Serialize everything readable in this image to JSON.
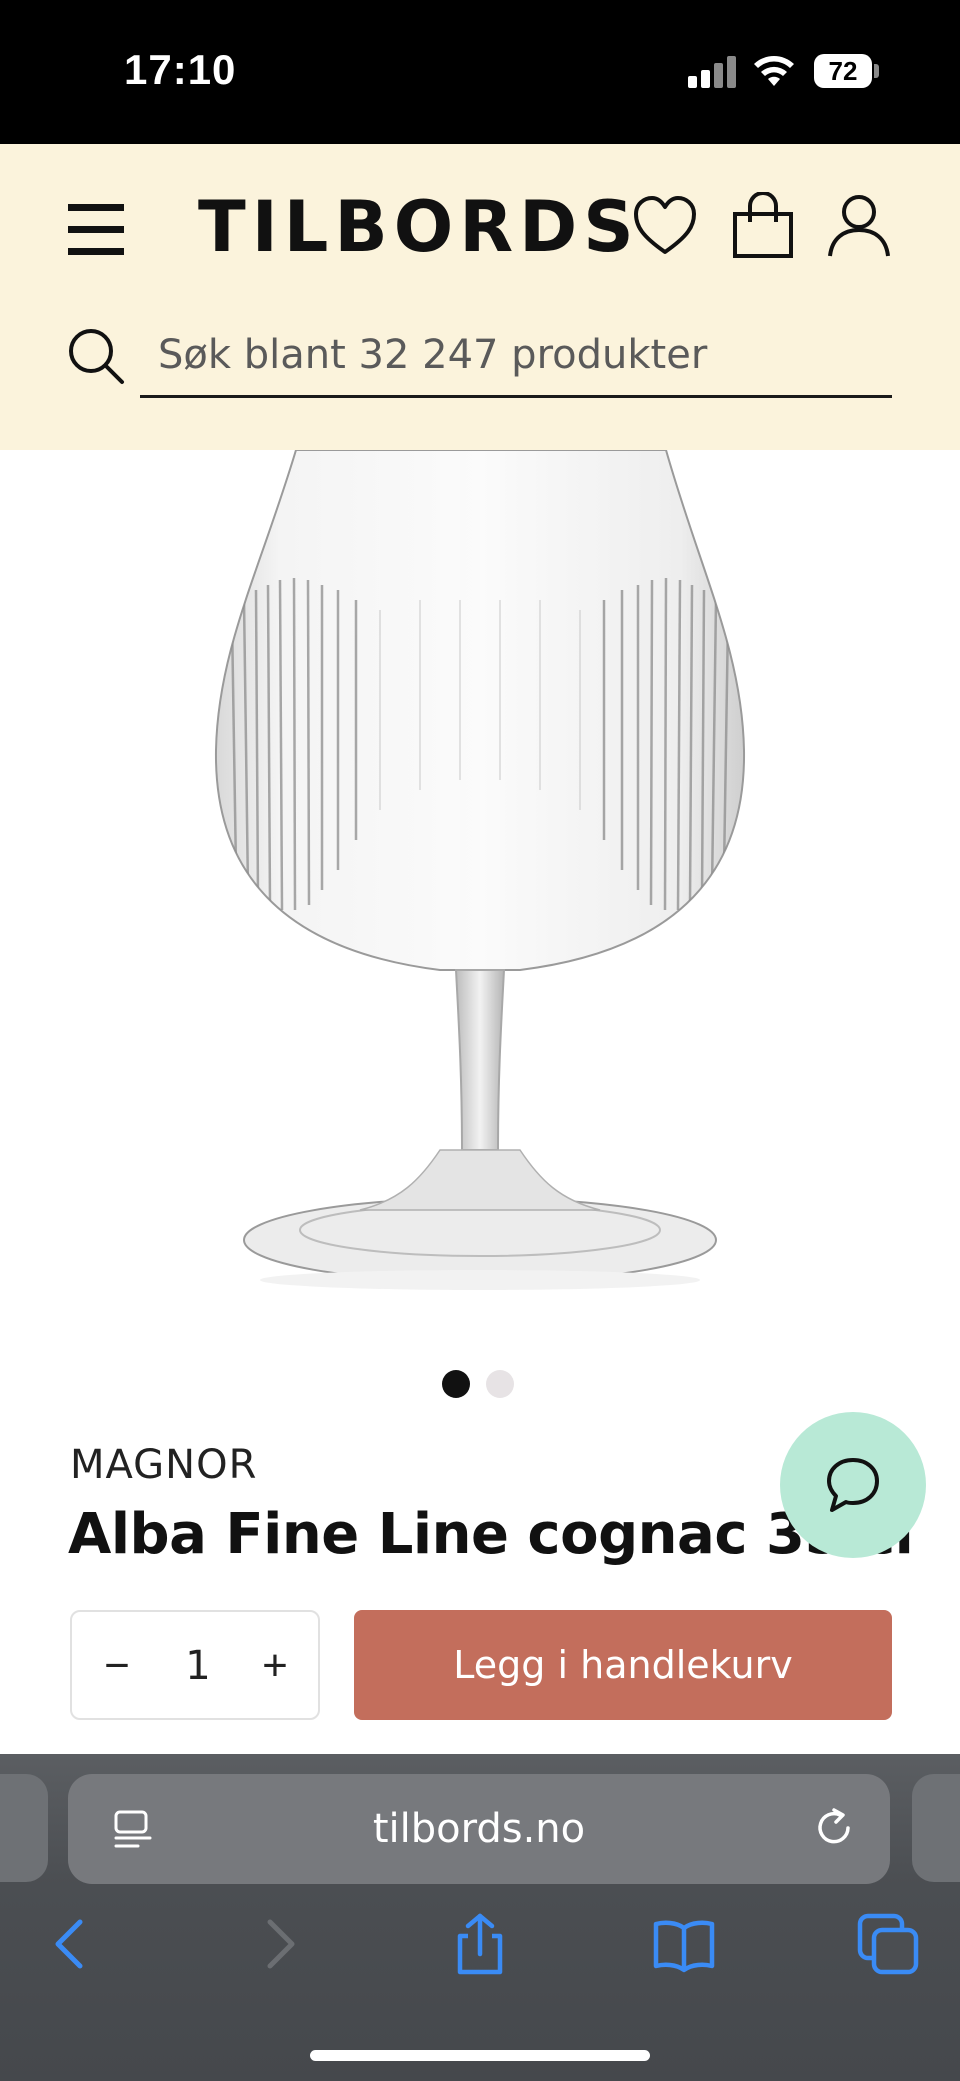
{
  "status_bar": {
    "time": "17:10",
    "battery": "72"
  },
  "header": {
    "logo": "TILBORDS",
    "search": {
      "placeholder": "Søk blant 32 247 produkter",
      "value": ""
    }
  },
  "product": {
    "image_count": 2,
    "active_image": 1,
    "brand": "MAGNOR",
    "title": "Alba Fine Line cognac 35 cl",
    "quantity": "1",
    "qty_minus": "−",
    "qty_plus": "+",
    "add_to_cart_label": "Legg i handlekurv"
  },
  "browser": {
    "url": "tilbords.no"
  },
  "colors": {
    "header_bg": "#fbf3dc",
    "add_to_cart": "#c36e5c",
    "chat_button": "#b8e9d6"
  },
  "icons": {
    "menu": "hamburger-icon",
    "wishlist": "heart-icon",
    "cart": "shopping-bag-icon",
    "account": "user-icon",
    "search": "search-icon",
    "chat": "chat-bubble-icon"
  }
}
